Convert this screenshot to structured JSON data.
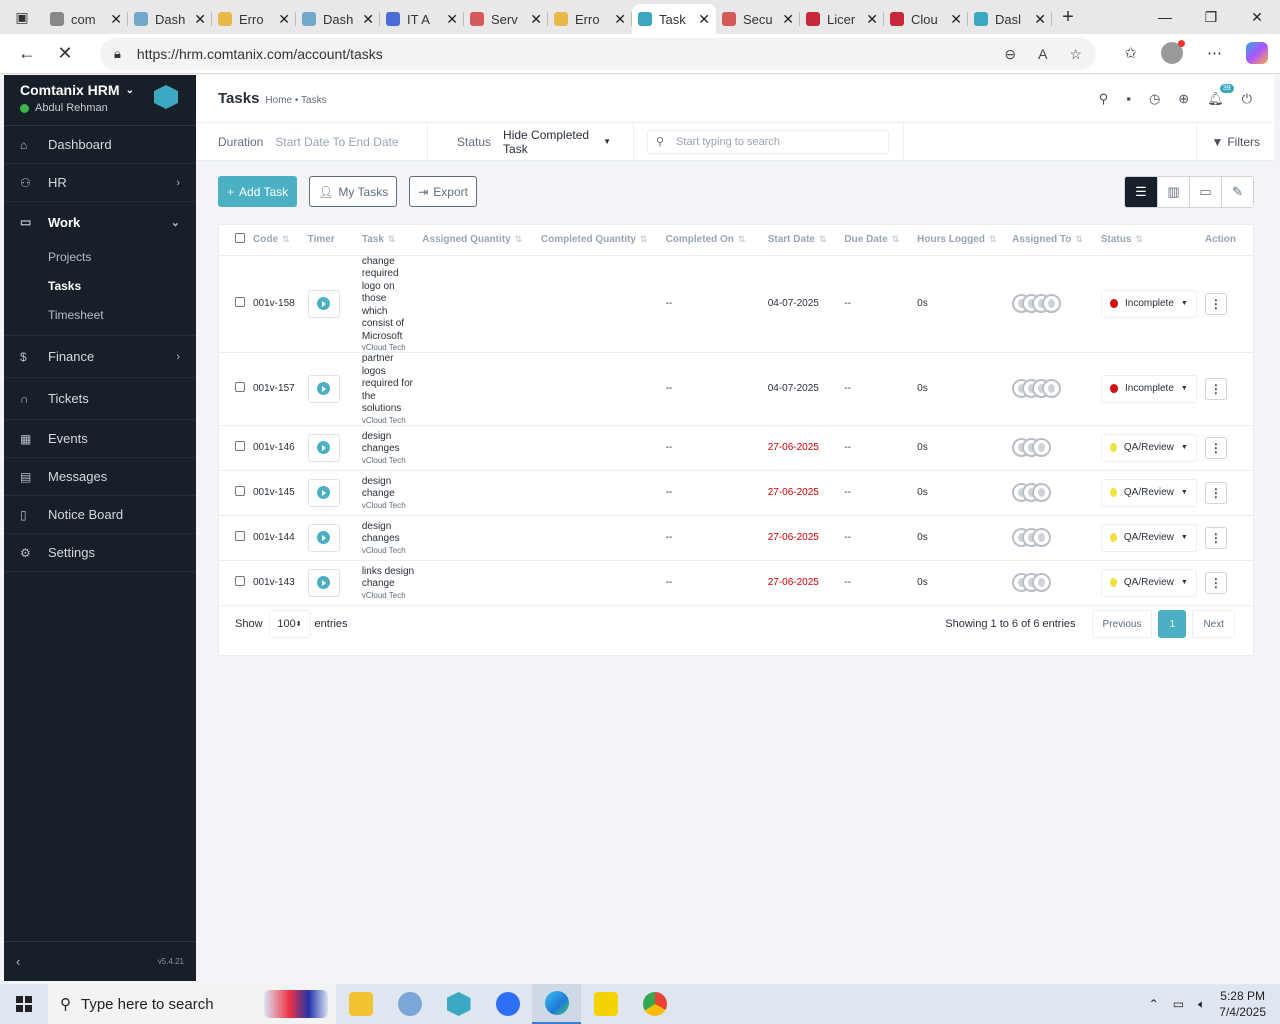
{
  "browser": {
    "tabs": [
      {
        "label": "com",
        "color": "#888888",
        "active": false
      },
      {
        "label": "Dash",
        "color": "#6fa8c8",
        "active": false
      },
      {
        "label": "Erro",
        "color": "#e8b84a",
        "active": false
      },
      {
        "label": "Dash",
        "color": "#6fa8c8",
        "active": false
      },
      {
        "label": "IT A",
        "color": "#4b6bd8",
        "active": false
      },
      {
        "label": "Serv",
        "color": "#d45a5a",
        "active": false
      },
      {
        "label": "Erro",
        "color": "#e8b84a",
        "active": false
      },
      {
        "label": "Task",
        "color": "#3aa8c1",
        "active": true
      },
      {
        "label": "Secu",
        "color": "#d45a5a",
        "active": false
      },
      {
        "label": "Licer",
        "color": "#c8283c",
        "active": false
      },
      {
        "label": "Clou",
        "color": "#c8283c",
        "active": false
      },
      {
        "label": "Dasl",
        "color": "#3aa8c1",
        "active": false
      }
    ],
    "url": "https://hrm.comtanix.com/account/tasks"
  },
  "sidebar": {
    "brand": "Comtanix HRM",
    "user": "Abdul Rehman",
    "items": [
      {
        "label": "Dashboard",
        "icon": "home-icon"
      },
      {
        "label": "HR",
        "icon": "users-icon"
      },
      {
        "label": "Work",
        "icon": "briefcase-icon"
      },
      {
        "label": "Finance",
        "icon": "dollar-icon"
      },
      {
        "label": "Tickets",
        "icon": "headset-icon"
      },
      {
        "label": "Events",
        "icon": "calendar-icon"
      },
      {
        "label": "Messages",
        "icon": "chat-icon"
      },
      {
        "label": "Notice Board",
        "icon": "clipboard-icon"
      },
      {
        "label": "Settings",
        "icon": "gear-icon"
      }
    ],
    "work_sub": [
      "Projects",
      "Tasks",
      "Timesheet"
    ],
    "version": "v5.4.21"
  },
  "header": {
    "title": "Tasks",
    "crumb_home": "Home",
    "crumb_sep": "•",
    "crumb_current": "Tasks",
    "notif_count": "39"
  },
  "filters": {
    "duration_label": "Duration",
    "duration_placeholder": "Start Date To End Date",
    "status_label": "Status",
    "status_value": "Hide Completed Task",
    "search_placeholder": "Start typing to search",
    "filters_label": "Filters"
  },
  "actions": {
    "add": "Add Task",
    "my": "My Tasks",
    "export": "Export"
  },
  "table": {
    "columns": [
      "Code",
      "Timer",
      "Task",
      "Assigned Quantity",
      "Completed Quantity",
      "Completed On",
      "Start Date",
      "Due Date",
      "Hours Logged",
      "Assigned To",
      "Status",
      "Action"
    ],
    "rows": [
      {
        "code": "001v-158",
        "task": "change required logo on those which consist of Microsoft",
        "lines": [
          "change",
          "required",
          "logo on",
          "those which",
          "consist of",
          "Microsoft"
        ],
        "project": "vCloud Tech",
        "completed_on": "--",
        "start": "04-07-2025",
        "overdue": false,
        "due": "--",
        "hours": "0s",
        "avatars": 4,
        "status": "Incomplete",
        "status_color": "#d21010"
      },
      {
        "code": "001v-157",
        "task": "partner logos required for the solutions",
        "lines": [
          "partner",
          "logos",
          "required for",
          "the solutions"
        ],
        "project": "vCloud Tech",
        "completed_on": "--",
        "start": "04-07-2025",
        "overdue": false,
        "due": "--",
        "hours": "0s",
        "avatars": 4,
        "status": "Incomplete",
        "status_color": "#d21010"
      },
      {
        "code": "001v-146",
        "task": "design changes",
        "lines": [
          "design",
          "changes"
        ],
        "project": "vCloud Tech",
        "completed_on": "--",
        "start": "27-06-2025",
        "overdue": true,
        "due": "--",
        "hours": "0s",
        "avatars": 3,
        "status": "QA/Review",
        "status_color": "#f0e040"
      },
      {
        "code": "001v-145",
        "task": "design change",
        "lines": [
          "design",
          "change"
        ],
        "project": "vCloud Tech",
        "completed_on": "--",
        "start": "27-06-2025",
        "overdue": true,
        "due": "--",
        "hours": "0s",
        "avatars": 3,
        "status": "QA/Review",
        "status_color": "#f0e040"
      },
      {
        "code": "001v-144",
        "task": "design changes",
        "lines": [
          "design",
          "changes"
        ],
        "project": "vCloud Tech",
        "completed_on": "--",
        "start": "27-06-2025",
        "overdue": true,
        "due": "--",
        "hours": "0s",
        "avatars": 3,
        "status": "QA/Review",
        "status_color": "#f0e040"
      },
      {
        "code": "001v-143",
        "task": "links design change",
        "lines": [
          "links design",
          "change"
        ],
        "project": "vCloud Tech",
        "completed_on": "--",
        "start": "27-06-2025",
        "overdue": true,
        "due": "--",
        "hours": "0s",
        "avatars": 3,
        "status": "QA/Review",
        "status_color": "#f0e040"
      }
    ]
  },
  "footer": {
    "show": "Show",
    "entries_value": "100",
    "entries": "entries",
    "info": "Showing 1 to 6 of 6 entries",
    "prev": "Previous",
    "page": "1",
    "next": "Next"
  },
  "taskbar": {
    "search": "Type here to search",
    "time": "5:28 PM",
    "date": "7/4/2025"
  }
}
